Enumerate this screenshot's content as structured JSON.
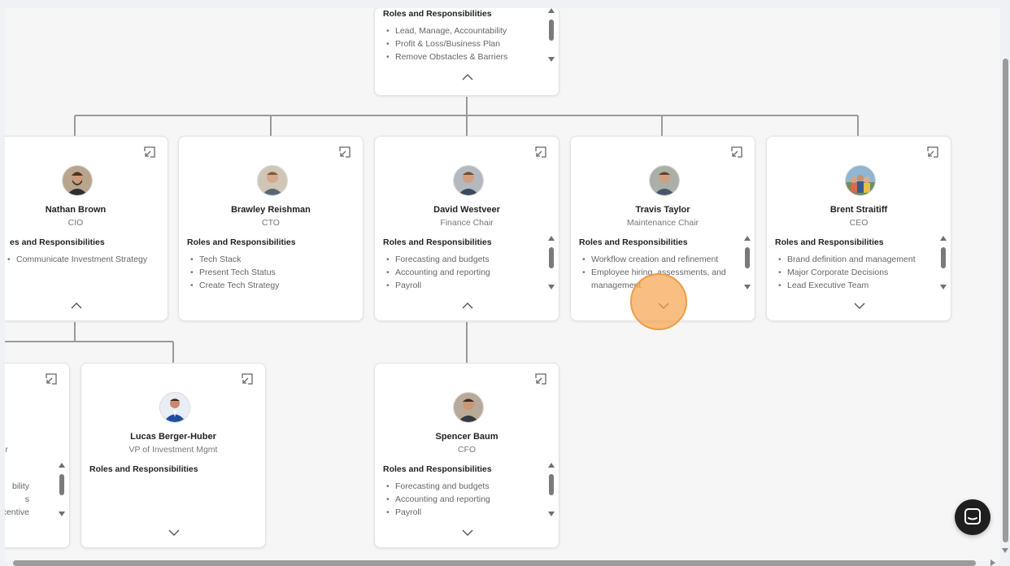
{
  "org_chart": {
    "roles_heading": "Roles and Responsibilities",
    "root": {
      "roles": [
        "Lead, Manage, Accountability",
        "Profit & Loss/Business Plan",
        "Remove Obstacles & Barriers"
      ]
    },
    "nathan": {
      "name": "Nathan Brown",
      "title": "CIO",
      "roles_heading_visible": "es and Responsibilities",
      "roles": [
        "Communicate Investment Strategy"
      ]
    },
    "brawley": {
      "name": "Brawley Reishman",
      "title": "CTO",
      "roles": [
        "Tech Stack",
        "Present Tech Status",
        "Create Tech Strategy"
      ]
    },
    "david": {
      "name": "David Westveer",
      "title": "Finance Chair",
      "roles": [
        "Forecasting and budgets",
        "Accounting and reporting",
        "Payroll"
      ]
    },
    "travis": {
      "name": "Travis Taylor",
      "title": "Maintenance Chair",
      "roles": [
        "Workflow creation and refinement",
        "Employee hiring, assessments, and management"
      ]
    },
    "brent": {
      "name": "Brent Straitiff",
      "title": "CEO",
      "roles": [
        "Brand definition and management",
        "Major Corporate Decisions",
        "Lead Executive Team"
      ]
    },
    "partial": {
      "title_tail": "er",
      "roles": [
        "bility",
        "s",
        "centive"
      ]
    },
    "lucas": {
      "name": "Lucas Berger-Huber",
      "title": "VP of Investment Mgmt",
      "roles": []
    },
    "spencer": {
      "name": "Spencer Baum",
      "title": "CFO",
      "roles": [
        "Forecasting and budgets",
        "Accounting and reporting",
        "Payroll"
      ]
    }
  },
  "colors": {
    "connector": "#9a9a9a",
    "cursor_ring": "#f6a550",
    "chat_button": "#1f1f1f"
  },
  "icons": {
    "card_expand": "expand-arrow-icon",
    "collapse": "chevron-up-icon",
    "expand": "chevron-down-icon",
    "chat": "chat-bubble-icon"
  }
}
